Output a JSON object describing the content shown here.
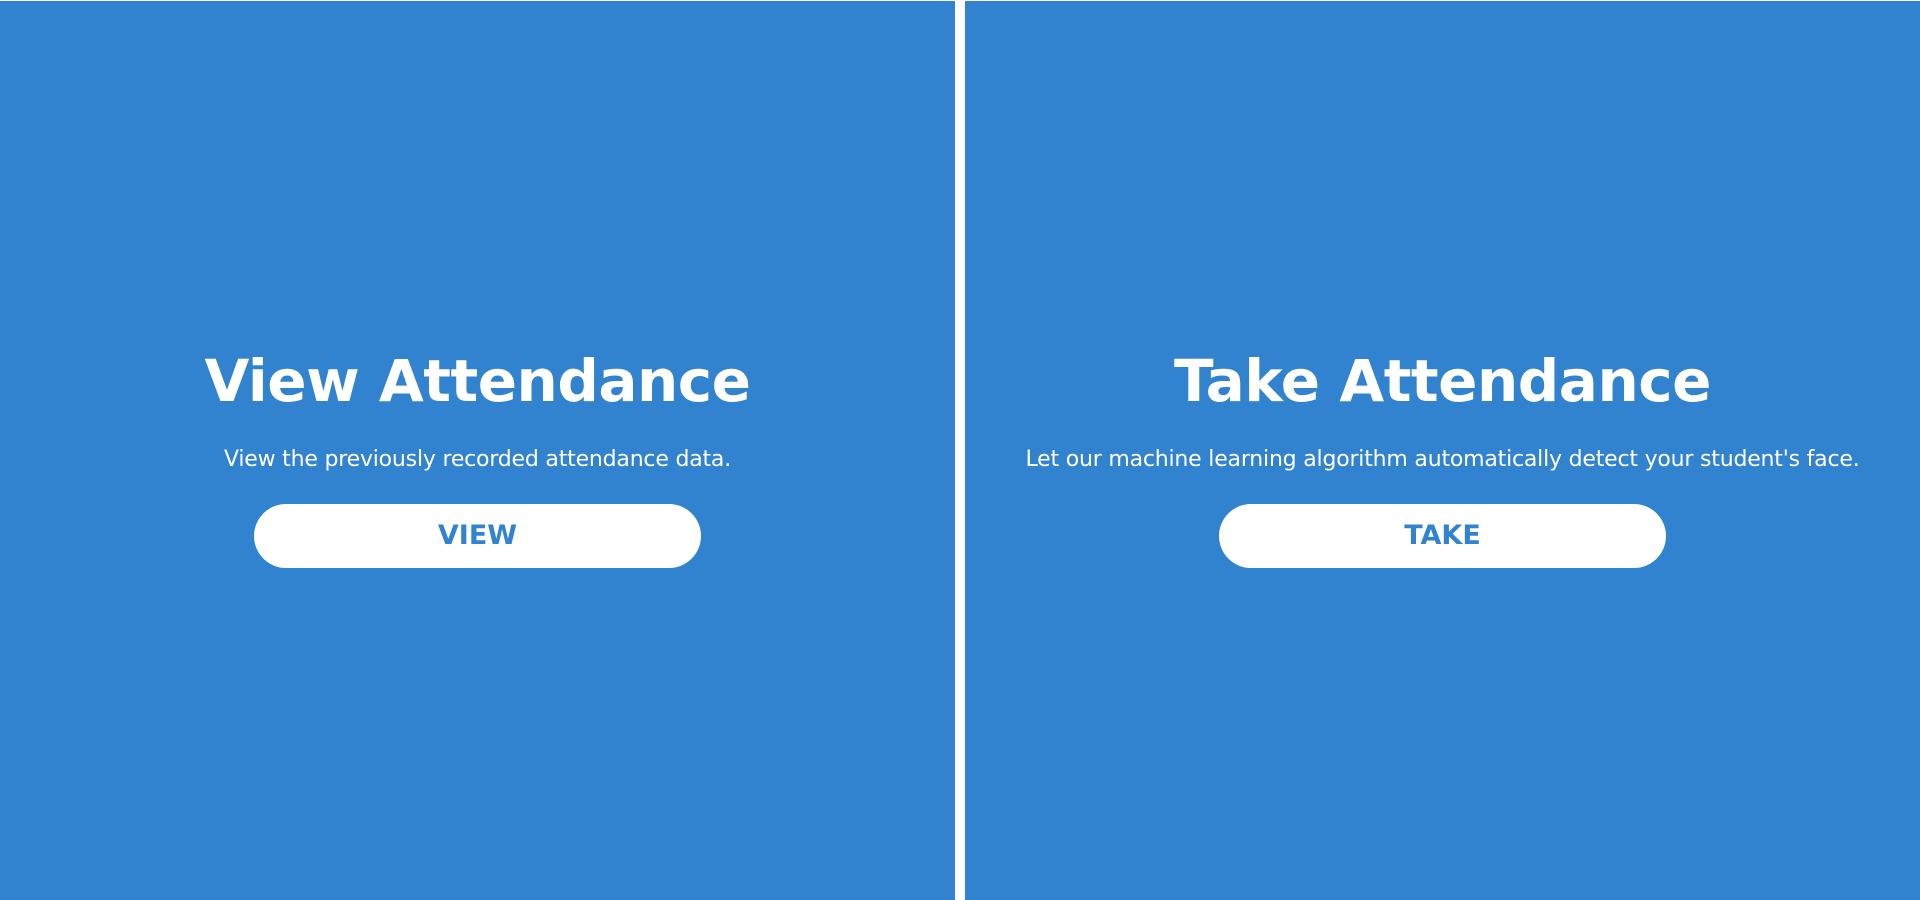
{
  "colors": {
    "panel_background": "#3182cf",
    "divider": "#ffffff",
    "text": "#ffffff",
    "button_background": "#ffffff",
    "button_text": "#3182cf"
  },
  "panels": [
    {
      "title": "View Attendance",
      "description": "View the previously recorded attendance data.",
      "button_label": "VIEW"
    },
    {
      "title": "Take Attendance",
      "description": "Let our machine learning algorithm automatically detect your student's face.",
      "button_label": "TAKE"
    }
  ]
}
